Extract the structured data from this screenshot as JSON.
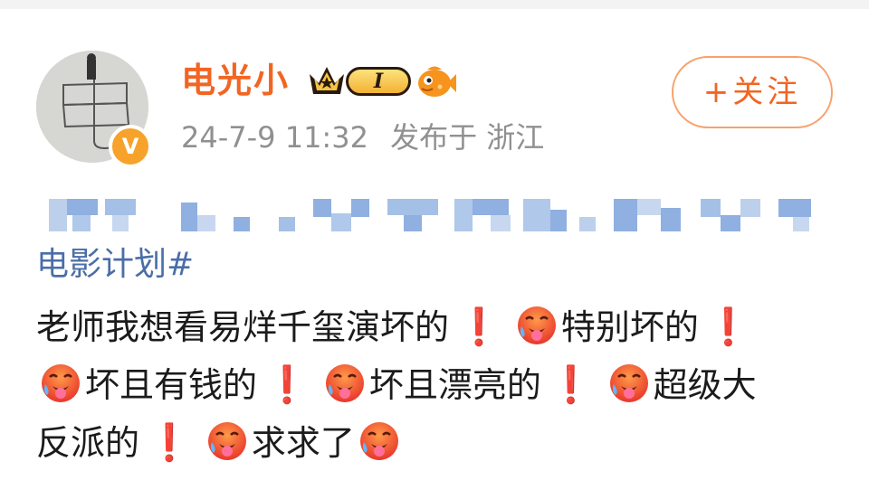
{
  "post": {
    "username": "电光小",
    "level": "I",
    "timestamp": "24-7-9 11:32",
    "published_at_label": "发布于 浙江",
    "follow_label": "+关注",
    "topic": "电影计划#",
    "lines": [
      {
        "parts": [
          {
            "t": "text",
            "v": "老师我想看易烊千玺演坏的"
          },
          {
            "t": "excl"
          },
          {
            "t": "emoji"
          },
          {
            "t": "text",
            "v": "特别坏的"
          },
          {
            "t": "excl"
          }
        ]
      },
      {
        "parts": [
          {
            "t": "emoji"
          },
          {
            "t": "text",
            "v": "坏且有钱的"
          },
          {
            "t": "excl"
          },
          {
            "t": "emoji"
          },
          {
            "t": "text",
            "v": "坏且漂亮的"
          },
          {
            "t": "excl"
          },
          {
            "t": "emoji"
          },
          {
            "t": "text",
            "v": "超级大"
          }
        ]
      },
      {
        "parts": [
          {
            "t": "text",
            "v": "反派的"
          },
          {
            "t": "excl"
          },
          {
            "t": "emoji"
          },
          {
            "t": "text",
            "v": "求求了"
          },
          {
            "t": "emoji"
          }
        ]
      }
    ],
    "exclamation": "❗",
    "emoji_name": "hot-face-emoji",
    "blurred_line": true
  },
  "colors": {
    "username": "#f26522",
    "topic": "#4a6ea8",
    "meta": "#909090",
    "accent": "#f7a22a"
  }
}
